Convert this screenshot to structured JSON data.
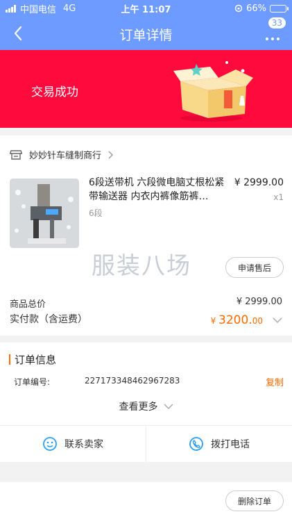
{
  "status_bar": {
    "carrier": "中国电信",
    "network": "4G",
    "time": "上午 11:07",
    "battery": "66%",
    "battery_level": 0.66
  },
  "header": {
    "title": "订单详情",
    "badge_count": "33"
  },
  "banner": {
    "status_text": "交易成功"
  },
  "order": {
    "shop_name": "妙妙针车缝制商行",
    "product": {
      "name": "6段送带机 六段微电脑丈根松紧带输送器 内衣内裤像筋裤…",
      "price": "¥ 2999.00",
      "quantity": "x1",
      "spec": "6段",
      "after_sale_label": "申请售后"
    },
    "watermark": "服装八场",
    "goods_total_label": "商品总价",
    "goods_total_value": "¥ 2999.00",
    "paid_label": "实付款（含运费）",
    "paid_currency": "¥ ",
    "paid_int": "3200.",
    "paid_dec": "00"
  },
  "order_info": {
    "title": "订单信息",
    "order_no_label": "订单编号:",
    "order_no": "227173348462967283",
    "copy_label": "复制",
    "see_more_label": "查看更多"
  },
  "actions": {
    "contact_seller": "联系卖家",
    "call_phone": "拨打电话"
  },
  "bottom": {
    "delete_order": "删除订单"
  },
  "colors": {
    "header_blue": "#6d9bff",
    "banner_red": "#ff0a3c",
    "accent_orange": "#ff6a00",
    "icon_blue": "#2a9df4"
  },
  "icons": {
    "back": "chevron-left-icon",
    "more": "more-dots-icon",
    "shop": "shop-icon",
    "shop_arrow": "chevron-right-icon",
    "expand": "chevron-down-icon",
    "contact": "chat-face-icon",
    "phone": "phone-icon",
    "banner": "gift-box-icon"
  }
}
